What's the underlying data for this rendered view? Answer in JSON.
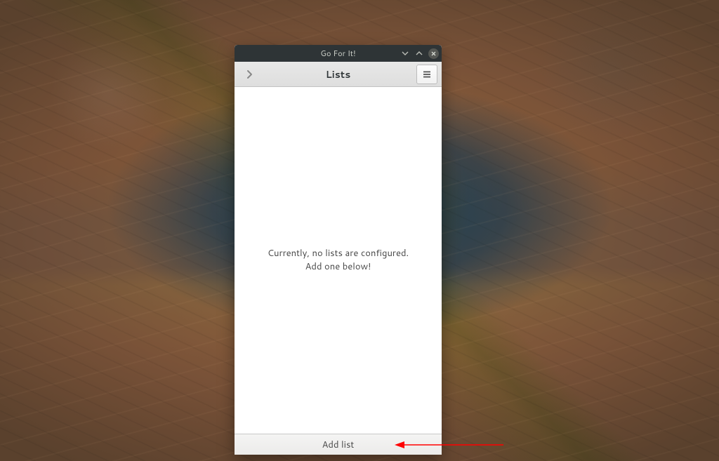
{
  "window": {
    "title": "Go For It!"
  },
  "header": {
    "title": "Lists"
  },
  "body": {
    "empty_line1": "Currently, no lists are configured.",
    "empty_line2": "Add one below!"
  },
  "footer": {
    "add_list_label": "Add list"
  },
  "annotation": {
    "arrow_color": "#ff0000"
  }
}
